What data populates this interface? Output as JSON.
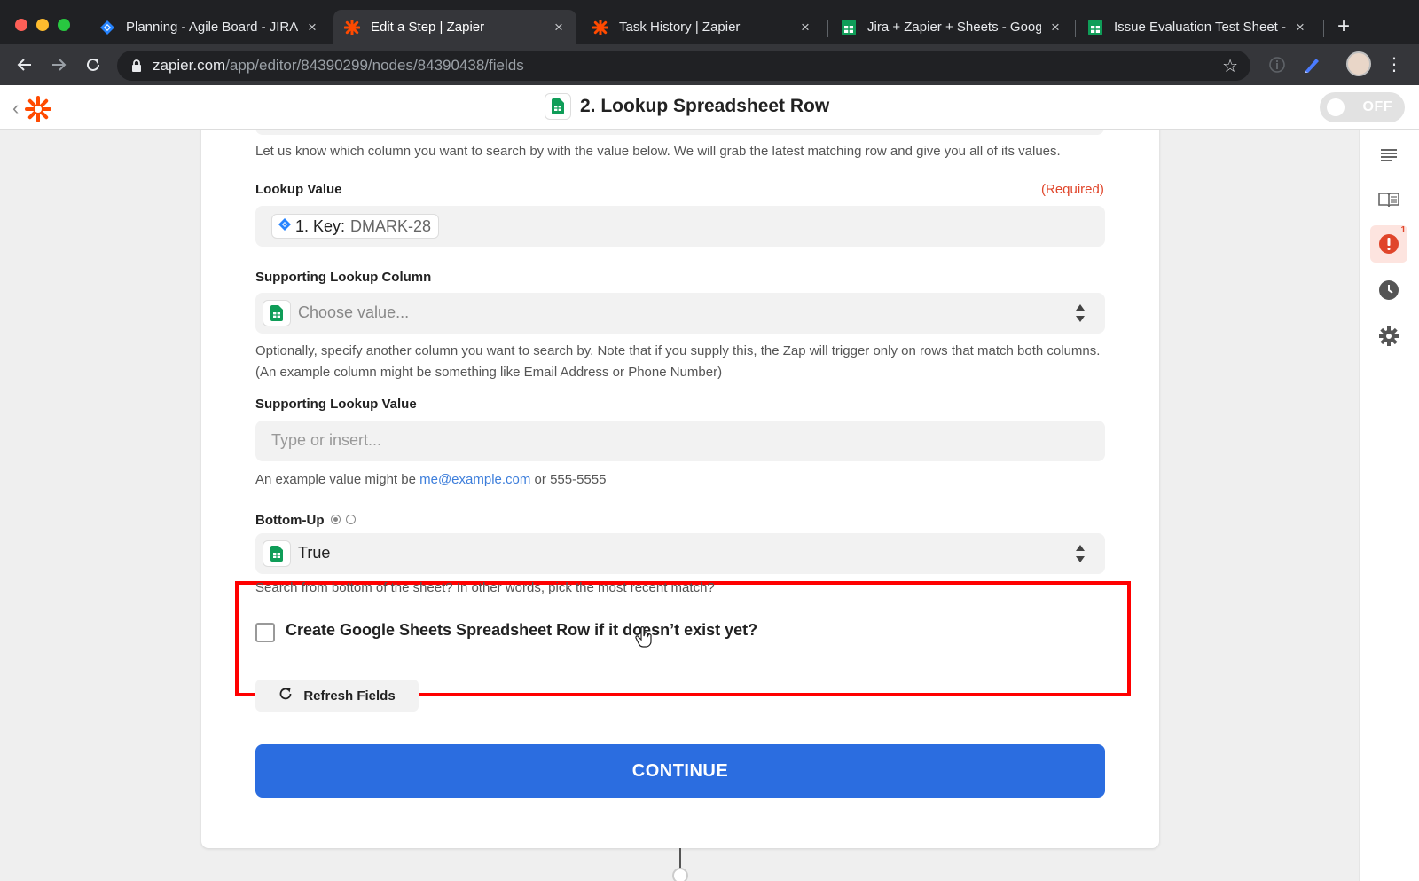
{
  "browser": {
    "tabs": [
      {
        "title": "Planning - Agile Board - JIRA",
        "favicon": "jira-icon",
        "close": "×"
      },
      {
        "title": "Edit a Step | Zapier",
        "favicon": "zapier-icon",
        "close": "×",
        "active": true
      },
      {
        "title": "Task History | Zapier",
        "favicon": "zapier-icon",
        "close": "×"
      },
      {
        "title": "Jira + Zapier + Sheets - Google",
        "favicon": "sheets-icon",
        "close": "×"
      },
      {
        "title": "Issue Evaluation Test Sheet - G",
        "favicon": "sheets-icon",
        "close": "×"
      }
    ],
    "new_tab": "+",
    "url_host": "zapier.com",
    "url_path": "/app/editor/84390299/nodes/84390438/fields"
  },
  "appbar": {
    "step_title": "2. Lookup Spreadsheet Row",
    "toggle_label": "OFF"
  },
  "right_rail": {
    "alert_count": "1",
    "icons": [
      "list-icon",
      "book-icon",
      "alert-icon",
      "clock-icon",
      "gear-icon"
    ]
  },
  "form": {
    "lookup_column_help": "Let us know which column you want to search by with the value below. We will grab the latest matching row and give you all of its values.",
    "lookup_value": {
      "label": "Lookup Value",
      "required": "(Required)",
      "pill_label": "1. Key:",
      "pill_value": "DMARK-28"
    },
    "supporting_lookup_column": {
      "label": "Supporting Lookup Column",
      "placeholder": "Choose value...",
      "help": "Optionally, specify another column you want to search by. Note that if you supply this, the Zap will trigger only on rows that match both columns. (An example column might be something like Email Address or Phone Number)"
    },
    "supporting_lookup_value": {
      "label": "Supporting Lookup Value",
      "placeholder": "Type or insert...",
      "help_prefix": "An example value might be ",
      "help_link": "me@example.com",
      "help_suffix": " or 555-5555"
    },
    "bottom_up": {
      "label": "Bottom-Up",
      "value": "True",
      "help": "Search from bottom of the sheet? In other words, pick the most recent match?"
    },
    "create_row_label": "Create Google Sheets Spreadsheet Row if it doesn’t exist yet?",
    "refresh_label": "Refresh Fields",
    "continue_label": "CONTINUE"
  },
  "colors": {
    "zapier_orange": "#ff4a00",
    "continue_blue": "#2b6de0",
    "highlight_red": "#ff0000",
    "required_red": "#e0452a",
    "link_blue": "#3d7edb",
    "sheets_green": "#0f9d58"
  }
}
